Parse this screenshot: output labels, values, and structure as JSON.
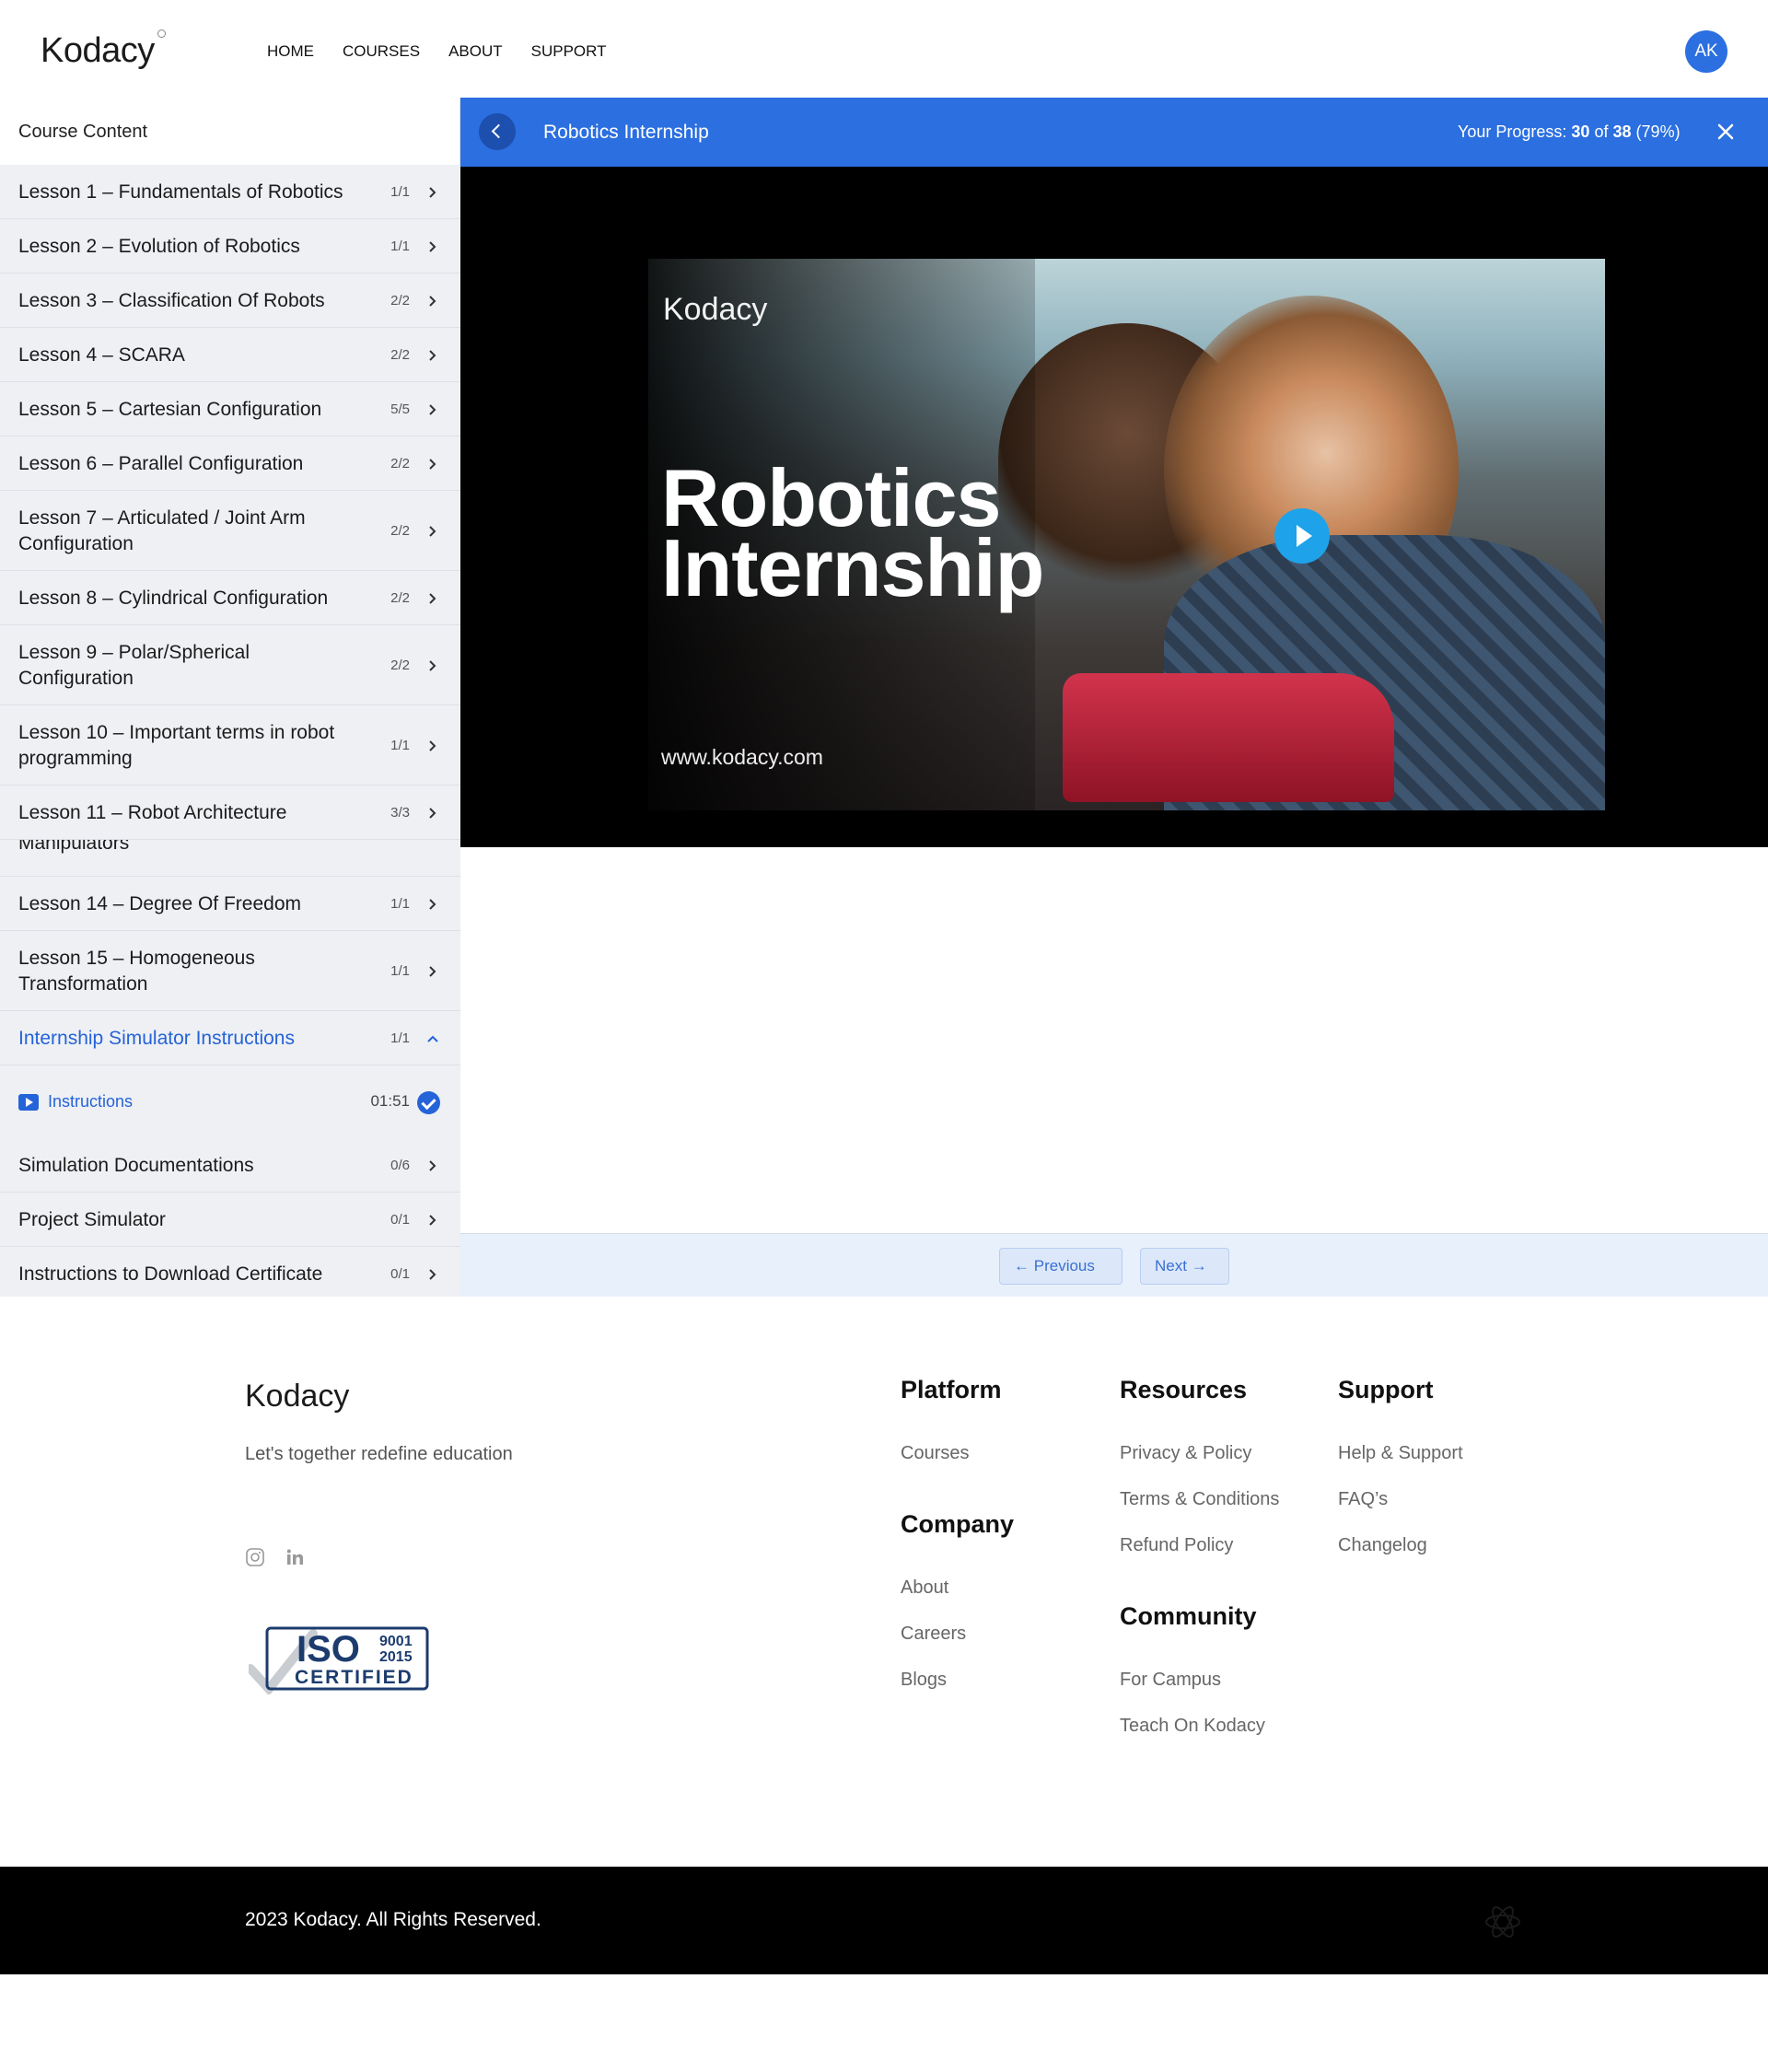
{
  "header": {
    "logo": "Kodacy",
    "nav": [
      "HOME",
      "COURSES",
      "ABOUT",
      "SUPPORT"
    ],
    "avatar_initials": "AK"
  },
  "sidebar": {
    "heading": "Course Content",
    "lessons": [
      {
        "title": "Lesson 1 – Fundamentals of Robotics",
        "count": "1/1"
      },
      {
        "title": "Lesson 2 – Evolution of Robotics",
        "count": "1/1"
      },
      {
        "title": "Lesson 3 – Classification Of Robots",
        "count": "2/2"
      },
      {
        "title": "Lesson 4 – SCARA",
        "count": "2/2"
      },
      {
        "title": "Lesson 5 – Cartesian Configuration",
        "count": "5/5"
      },
      {
        "title": "Lesson 6 – Parallel Configuration",
        "count": "2/2"
      },
      {
        "title": "Lesson 7 – Articulated / Joint Arm Configuration",
        "count": "2/2"
      },
      {
        "title": "Lesson 8 – Cylindrical Configuration",
        "count": "2/2"
      },
      {
        "title": "Lesson 9 – Polar/Spherical Configuration",
        "count": "2/2"
      },
      {
        "title": "Lesson 10 – Important terms in robot programming",
        "count": "1/1"
      },
      {
        "title": "Lesson 11 – Robot Architecture",
        "count": "3/3"
      },
      {
        "title": "Manipulators",
        "count": ""
      },
      {
        "title": "Lesson 14 – Degree Of Freedom",
        "count": "1/1"
      },
      {
        "title": "Lesson 15 – Homogeneous Transformation",
        "count": "1/1"
      },
      {
        "title": "Internship Simulator Instructions",
        "count": "1/1"
      },
      {
        "title": "Simulation Documentations",
        "count": "0/6"
      },
      {
        "title": "Project Simulator",
        "count": "0/1"
      },
      {
        "title": "Instructions to Download Certificate",
        "count": "0/1"
      }
    ],
    "active_sub": {
      "label": "Instructions",
      "duration": "01:51"
    }
  },
  "main": {
    "course_title": "Robotics Internship",
    "progress_label": "Your Progress:",
    "progress_done": "30",
    "progress_of": "of",
    "progress_total": "38",
    "progress_pct": "(79%)",
    "progress_fraction": 0.79,
    "video": {
      "brand": "Kodacy",
      "title_line1": "Robotics",
      "title_line2": "Internship",
      "url": "www.kodacy.com"
    },
    "prev_label": "Previous",
    "next_label": "Next"
  },
  "footer": {
    "logo": "Kodacy",
    "tagline": "Let's together redefine education",
    "iso": {
      "word": "ISO",
      "num1": "9001",
      "num2": "2015",
      "certified": "CERTIFIED"
    },
    "platform": {
      "heading": "Platform",
      "links": [
        "Courses"
      ]
    },
    "company": {
      "heading": "Company",
      "links": [
        "About",
        "Careers",
        "Blogs"
      ]
    },
    "resources": {
      "heading": "Resources",
      "links": [
        "Privacy & Policy",
        "Terms & Conditions",
        "Refund Policy"
      ]
    },
    "community": {
      "heading": "Community",
      "links": [
        "For Campus",
        "Teach On Kodacy"
      ]
    },
    "support": {
      "heading": "Support",
      "links": [
        "Help & Support",
        "FAQ’s",
        "Changelog"
      ]
    },
    "copyright": "2023 Kodacy. All Rights Reserved."
  },
  "colors": {
    "accent": "#2b6fe0",
    "active_text": "#2563d8",
    "play_button": "#1ea2ea"
  }
}
